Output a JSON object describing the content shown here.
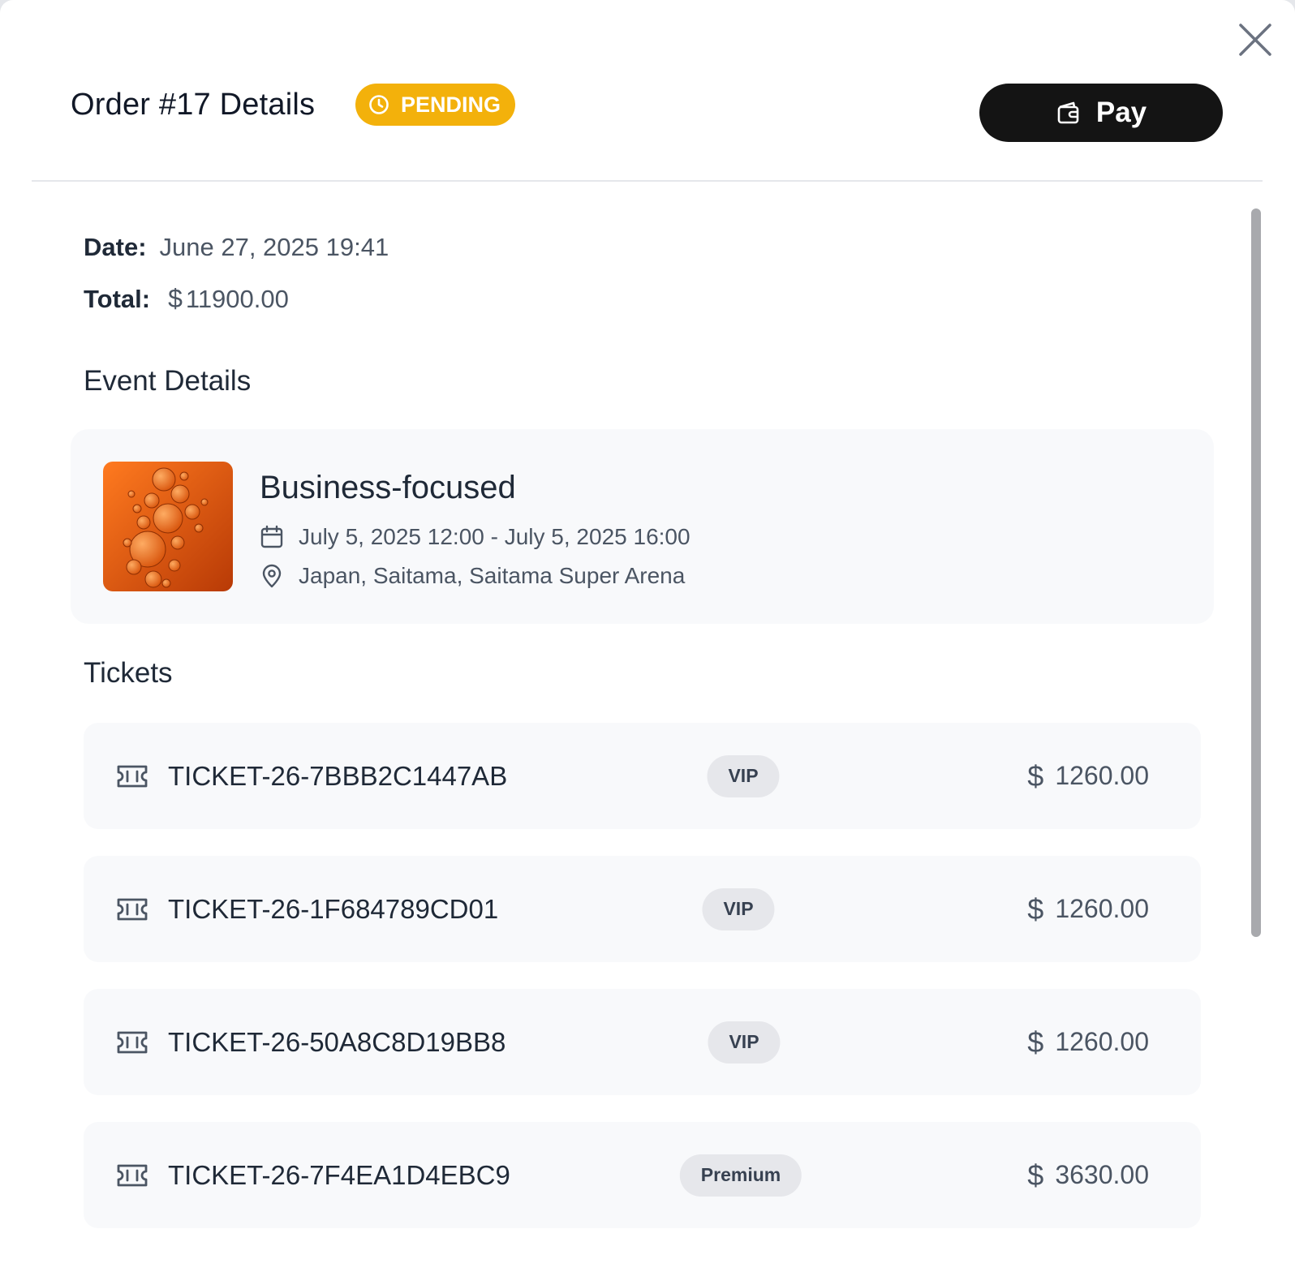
{
  "order": {
    "title": "Order #17 Details",
    "status": "PENDING",
    "pay_label": "Pay",
    "date_label": "Date:",
    "date_value": "June 27, 2025 19:41",
    "total_label": "Total:",
    "total_currency": "$",
    "total_value": "11900.00"
  },
  "event_section": {
    "title": "Event Details",
    "name": "Business-focused",
    "date_range": "July 5, 2025 12:00 - July 5, 2025 16:00",
    "location": "Japan, Saitama, Saitama Super Arena"
  },
  "tickets_section": {
    "title": "Tickets",
    "items": [
      {
        "id": "TICKET-26-7BBB2C1447AB",
        "tier": "VIP",
        "currency": "$",
        "price": "1260.00"
      },
      {
        "id": "TICKET-26-1F684789CD01",
        "tier": "VIP",
        "currency": "$",
        "price": "1260.00"
      },
      {
        "id": "TICKET-26-50A8C8D19BB8",
        "tier": "VIP",
        "currency": "$",
        "price": "1260.00"
      },
      {
        "id": "TICKET-26-7F4EA1D4EBC9",
        "tier": "Premium",
        "currency": "$",
        "price": "3630.00"
      }
    ]
  },
  "icons": {
    "close": "close-icon",
    "status": "clock-icon",
    "pay": "wallet-icon",
    "event_date": "calendar-icon",
    "event_location": "map-pin-icon",
    "ticket": "ticket-icon"
  },
  "colors": {
    "status_badge": "#f3b10b",
    "pay_button": "#141414",
    "card_bg": "#f8f9fb",
    "tier_badge": "#e6e7eb"
  }
}
